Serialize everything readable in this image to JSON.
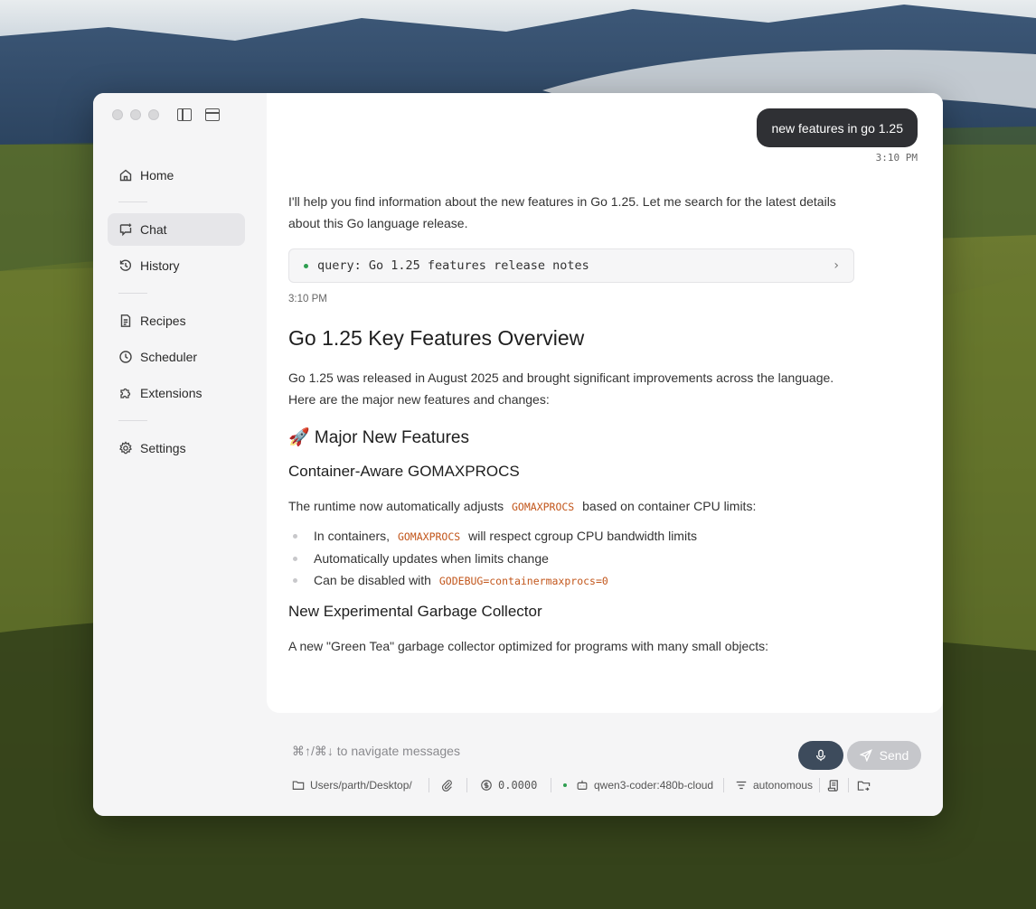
{
  "sidebar": {
    "items": [
      {
        "label": "Home",
        "icon": "home-icon"
      },
      {
        "label": "Chat",
        "icon": "chat-icon",
        "active": true
      },
      {
        "label": "History",
        "icon": "history-icon"
      },
      {
        "label": "Recipes",
        "icon": "recipes-icon"
      },
      {
        "label": "Scheduler",
        "icon": "clock-icon"
      },
      {
        "label": "Extensions",
        "icon": "puzzle-icon"
      },
      {
        "label": "Settings",
        "icon": "gear-icon"
      }
    ]
  },
  "chat": {
    "user_message": "new features in go 1.25",
    "user_time": "3:10 PM",
    "intro": "I'll help you find information about the new features in Go 1.25. Let me search for the latest details about this Go language release.",
    "tool_call": "query: Go 1.25 features release notes",
    "assistant_time": "3:10 PM",
    "heading": "Go 1.25 Key Features Overview",
    "summary": "Go 1.25 was released in August 2025 and brought significant improvements across the language. Here are the major new features and changes:",
    "section_title": "🚀 Major New Features",
    "sub1": {
      "title": "Container-Aware GOMAXPROCS",
      "text_before": "The runtime now automatically adjusts",
      "code": "GOMAXPROCS",
      "text_after": "based on container CPU limits:",
      "bullets": [
        {
          "before": "In containers,",
          "code": "GOMAXPROCS",
          "after": "will respect cgroup CPU bandwidth limits"
        },
        {
          "before": "Automatically updates when limits change",
          "code": "",
          "after": ""
        },
        {
          "before": "Can be disabled with",
          "code": "GODEBUG=containermaxprocs=0",
          "after": ""
        }
      ]
    },
    "sub2": {
      "title": "New Experimental Garbage Collector",
      "text": "A new \"Green Tea\" garbage collector optimized for programs with many small objects:"
    }
  },
  "composer": {
    "placeholder": "⌘↑/⌘↓ to navigate messages",
    "send_label": "Send",
    "path": "Users/parth/Desktop/",
    "cost": "0.0000",
    "model": "qwen3-coder:480b-cloud",
    "mode": "autonomous"
  },
  "colors": {
    "accent_dark": "#2f3034",
    "mic_bg": "#3d4b5c",
    "code_orange": "#c2561b",
    "status_green": "#2e9e50"
  }
}
